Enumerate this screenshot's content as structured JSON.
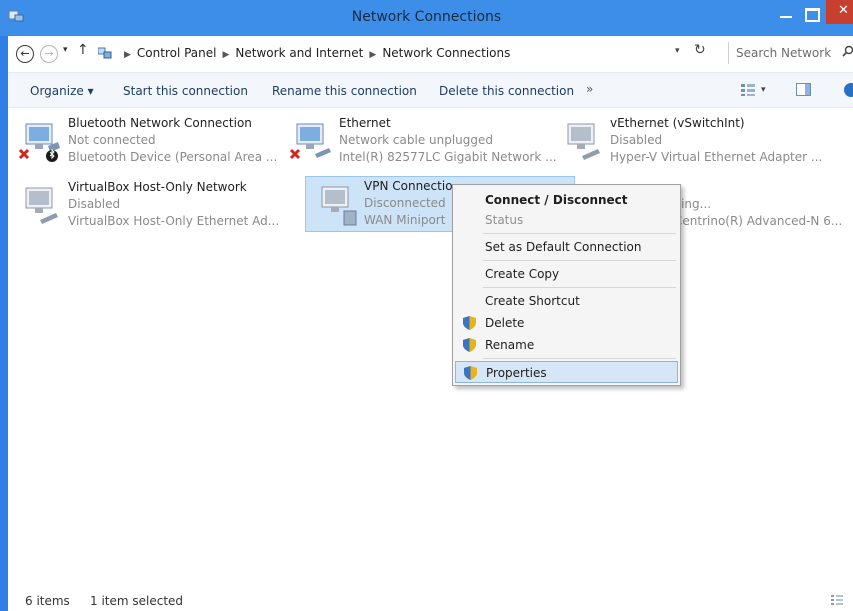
{
  "window": {
    "title": "Network Connections"
  },
  "nav": {
    "back_label": "←",
    "forward_label": "→",
    "up_label": "↑",
    "breadcrumbs": [
      "Control Panel",
      "Network and Internet",
      "Network Connections"
    ],
    "search_placeholder": "Search Network ..."
  },
  "toolbar": {
    "organize": "Organize ▾",
    "start": "Start this connection",
    "rename": "Rename this connection",
    "delete": "Delete this connection",
    "more": "»"
  },
  "items": [
    {
      "name": "Bluetooth Network Connection",
      "status": "Not connected",
      "device": "Bluetooth Device (Personal Area ...",
      "icon": "network-adapter-icon"
    },
    {
      "name": "Ethernet",
      "status": "Network cable unplugged",
      "device": "Intel(R) 82577LC Gigabit Network ...",
      "icon": "network-adapter-icon"
    },
    {
      "name": "vEthernet (vSwitchInt)",
      "status": "Disabled",
      "device": "Hyper-V Virtual Ethernet Adapter ...",
      "icon": "network-adapter-icon"
    },
    {
      "name": "VirtualBox Host-Only Network",
      "status": "Disabled",
      "device": "VirtualBox Host-Only Ethernet Ad...",
      "icon": "network-adapter-icon"
    },
    {
      "name": "VPN Connectio",
      "status": "Disconnected",
      "device": "WAN Miniport",
      "icon": "vpn-connection-icon"
    },
    {
      "name": "",
      "status": "ying...",
      "device": "Centrino(R) Advanced-N 6...",
      "icon": "wireless-adapter-icon"
    }
  ],
  "context_menu": {
    "connect": "Connect / Disconnect",
    "status": "Status",
    "set_default": "Set as Default Connection",
    "create_copy": "Create Copy",
    "create_shortcut": "Create Shortcut",
    "delete": "Delete",
    "rename": "Rename",
    "properties": "Properties"
  },
  "statusbar": {
    "count": "6 items",
    "selected": "1 item selected"
  },
  "colors": {
    "titlebar": "#3d8ee8",
    "accent": "#2f7fe6",
    "selection": "#cde3f7",
    "close": "#c7402f"
  }
}
